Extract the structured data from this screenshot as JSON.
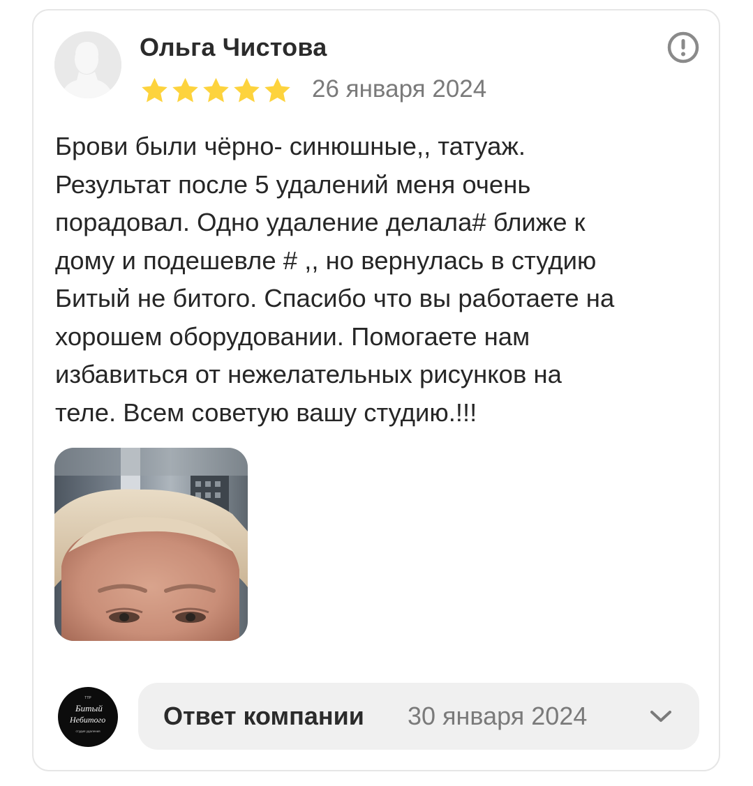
{
  "review": {
    "author_name": "Ольга Чистова",
    "rating": 5,
    "rating_max": 5,
    "date": "26 января 2024",
    "text": "Брови были чёрно- синюшные,, татуаж.\nРезультат после 5 удалений меня очень\nпорадовал. Одно удаление делала# ближе к\nдому и подешевле # ,, но вернулась в студию\nБитый не битого. Спасибо что вы работаете на\nхорошем оборудовании. Помогаете нам\nизбавиться от нежелательных рисунков на\nтеле. Всем советую вашу студию.!!!",
    "avatar_icon": "default-user-silhouette-icon",
    "complain_icon": "exclamation-circle-icon",
    "photo_count": 1
  },
  "company_reply": {
    "title": "Ответ компании",
    "date": "30 января 2024",
    "logo": {
      "top_small": "ТТР",
      "line1": "Битый",
      "line2": "Небитого",
      "bottom_small": "студия удаления"
    },
    "expand_icon": "chevron-down-icon"
  },
  "colors": {
    "star": "#fdd33d",
    "border": "#e6e6e6",
    "reply_bg": "#f0f0f0",
    "muted_text": "#7a7a7a",
    "main_text": "#262626"
  }
}
